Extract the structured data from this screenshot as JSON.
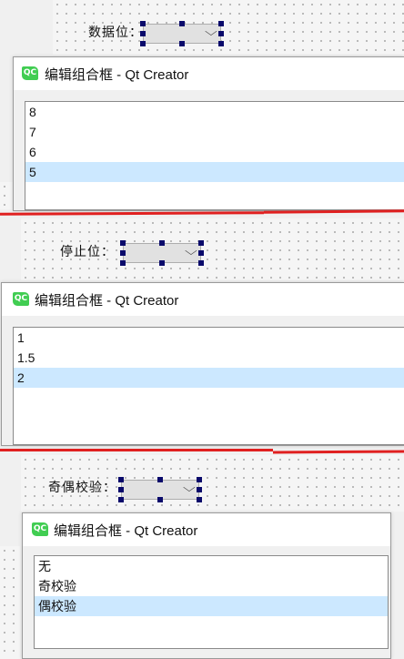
{
  "dialog": {
    "title": "编辑组合框 - Qt Creator",
    "logo_text": "QC"
  },
  "combo_arrow": "⌵",
  "colors": {
    "selection": "#cce8ff",
    "qt_green": "#41cd52",
    "separator": "#e02020",
    "handle": "#0a0a6b"
  },
  "sections": [
    {
      "label": "数据位：",
      "items": [
        "8",
        "7",
        "6",
        "5"
      ],
      "selected_index": 3
    },
    {
      "label": "停止位：",
      "items": [
        "1",
        "1.5",
        "2"
      ],
      "selected_index": 2
    },
    {
      "label": "奇偶校验：",
      "items": [
        "无",
        "奇校验",
        "偶校验"
      ],
      "selected_index": 2
    }
  ]
}
